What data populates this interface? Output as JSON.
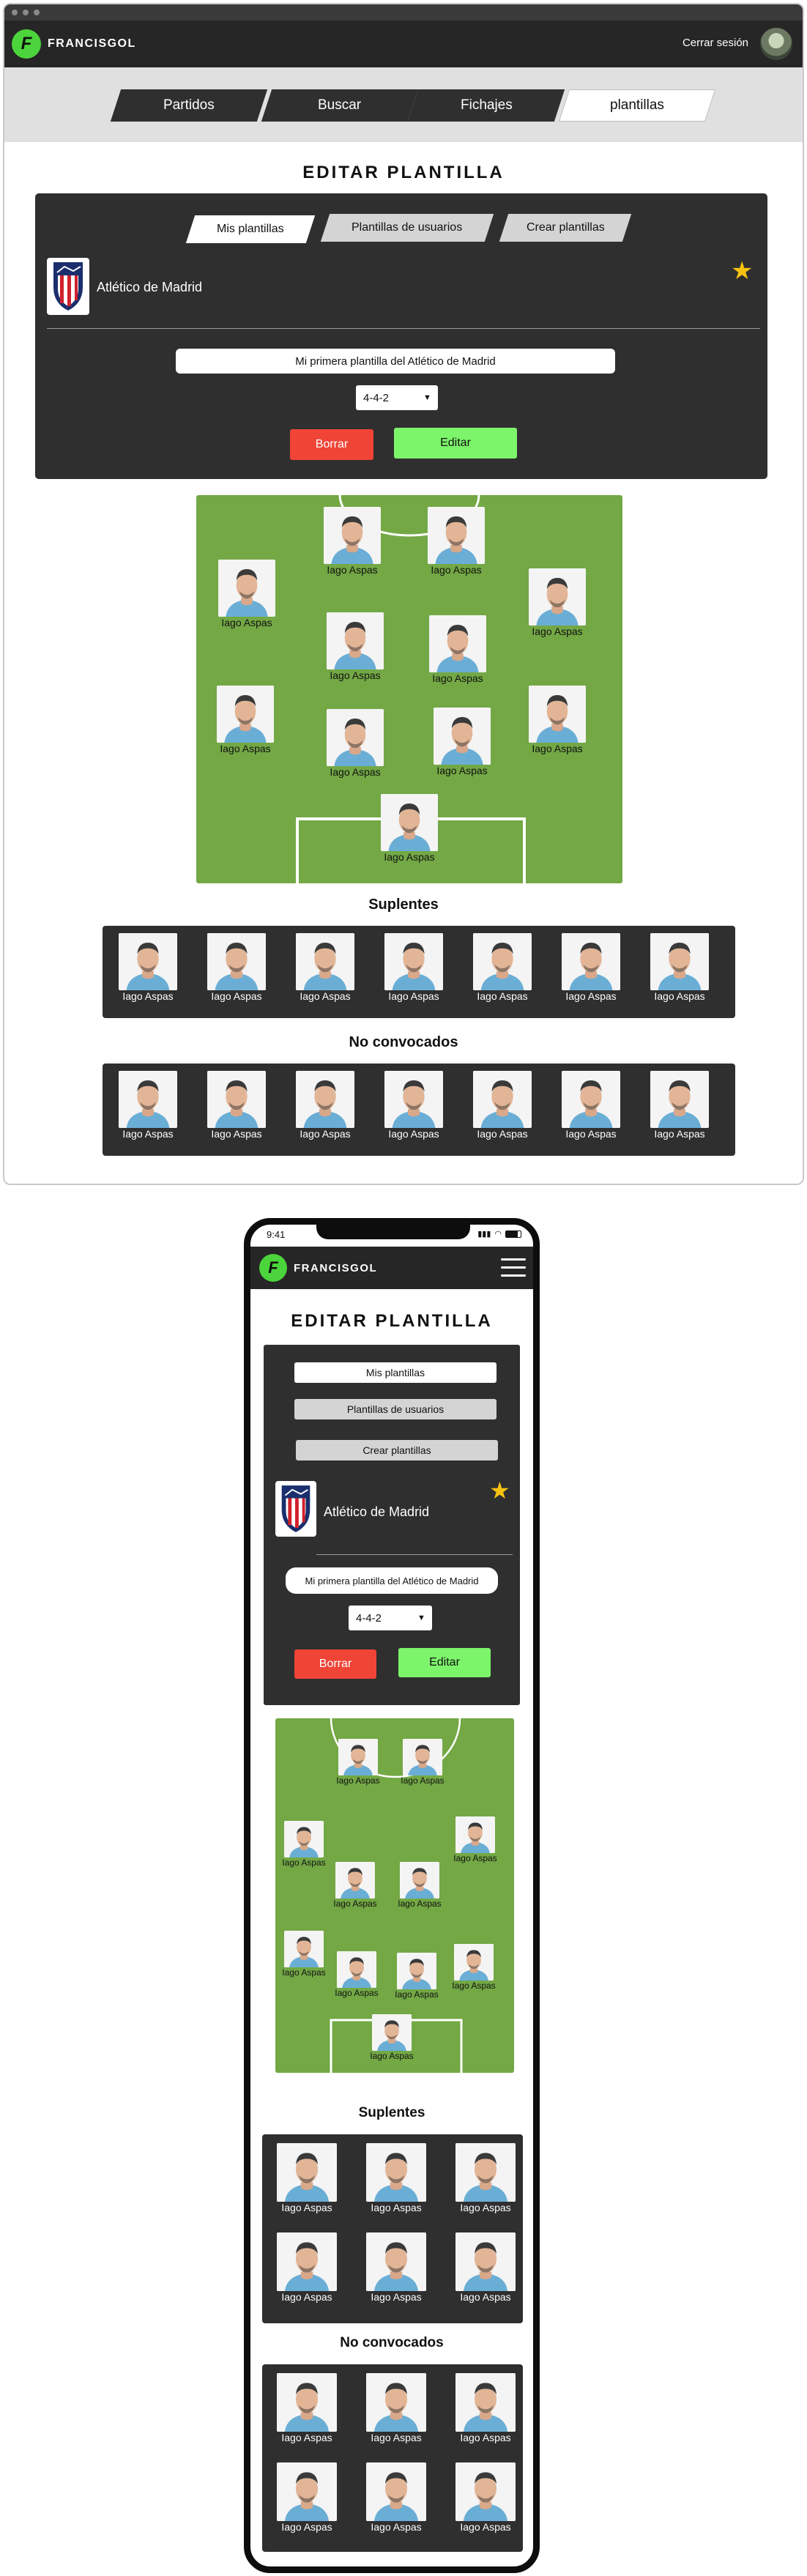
{
  "app": {
    "name": "FRANCISGOL",
    "logo_letter": "F"
  },
  "header": {
    "logout": "Cerrar sesión"
  },
  "nav": {
    "tabs": [
      "Partidos",
      "Buscar",
      "Fichajes",
      "plantillas"
    ],
    "active": 3
  },
  "page": {
    "title": "EDITAR PLANTILLA"
  },
  "subtabs": [
    "Mis plantillas",
    "Plantillas de usuarios",
    "Crear plantillas"
  ],
  "club": {
    "name": "Atlético de Madrid",
    "favorite": true
  },
  "lineup": {
    "name": "Mi primera plantilla del Atlético de Madrid",
    "formation": "4-4-2",
    "delete_label": "Borrar",
    "edit_label": "Editar"
  },
  "pitch_players": [
    {
      "name": "Iago Aspas"
    },
    {
      "name": "Iago Aspas"
    },
    {
      "name": "Iago Aspas"
    },
    {
      "name": "Iago Aspas"
    },
    {
      "name": "Iago Aspas"
    },
    {
      "name": "Iago Aspas"
    },
    {
      "name": "Iago Aspas"
    },
    {
      "name": "Iago Aspas"
    },
    {
      "name": "Iago Aspas"
    },
    {
      "name": "Iago Aspas"
    },
    {
      "name": "Iago Aspas"
    }
  ],
  "sections": {
    "substitutes": "Suplentes",
    "not_called": "No convocados"
  },
  "substitutes": [
    {
      "name": "Iago Aspas"
    },
    {
      "name": "Iago Aspas"
    },
    {
      "name": "Iago Aspas"
    },
    {
      "name": "Iago Aspas"
    },
    {
      "name": "Iago Aspas"
    },
    {
      "name": "Iago Aspas"
    },
    {
      "name": "Iago Aspas"
    }
  ],
  "not_called": [
    {
      "name": "Iago Aspas"
    },
    {
      "name": "Iago Aspas"
    },
    {
      "name": "Iago Aspas"
    },
    {
      "name": "Iago Aspas"
    },
    {
      "name": "Iago Aspas"
    },
    {
      "name": "Iago Aspas"
    },
    {
      "name": "Iago Aspas"
    }
  ],
  "mobile": {
    "time": "9:41",
    "substitutes": [
      {
        "name": "Iago Aspas"
      },
      {
        "name": "Iago Aspas"
      },
      {
        "name": "Iago Aspas"
      },
      {
        "name": "Iago Aspas"
      },
      {
        "name": "Iago Aspas"
      },
      {
        "name": "Iago Aspas"
      }
    ],
    "not_called": [
      {
        "name": "Iago Aspas"
      },
      {
        "name": "Iago Aspas"
      },
      {
        "name": "Iago Aspas"
      },
      {
        "name": "Iago Aspas"
      },
      {
        "name": "Iago Aspas"
      },
      {
        "name": "Iago Aspas"
      }
    ]
  },
  "colors": {
    "accent": "#4cd43c",
    "dark": "#2f2f2f",
    "pitch": "#73a845",
    "delete": "#f04437",
    "edit": "#7df56b",
    "star": "#f5c211"
  }
}
